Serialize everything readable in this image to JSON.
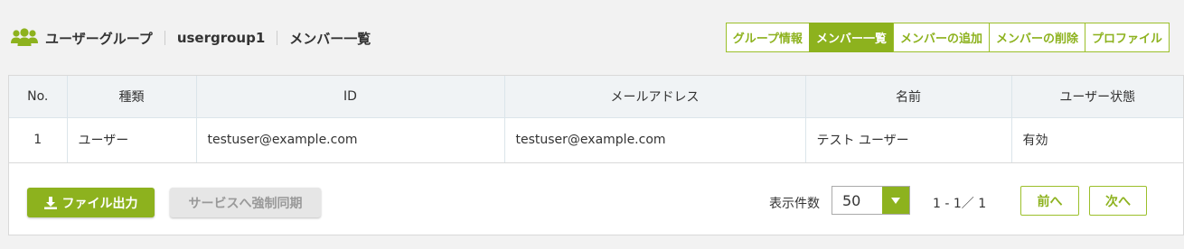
{
  "header": {
    "title": "ユーザーグループ",
    "group_name": "usergroup1",
    "page_name": "メンバー一覧"
  },
  "tabs": [
    {
      "label": "グループ情報",
      "active": false
    },
    {
      "label": "メンバー一覧",
      "active": true
    },
    {
      "label": "メンバーの追加",
      "active": false
    },
    {
      "label": "メンバーの削除",
      "active": false
    },
    {
      "label": "プロファイル",
      "active": false
    }
  ],
  "table": {
    "columns": [
      "No.",
      "種類",
      "ID",
      "メールアドレス",
      "名前",
      "ユーザー状態"
    ],
    "rows": [
      [
        "1",
        "ユーザー",
        "testuser@example.com",
        "testuser@example.com",
        "テスト ユーザー",
        "有効"
      ]
    ]
  },
  "footer": {
    "export_label": "ファイル出力",
    "sync_label": "サービスへ強制同期",
    "per_page_label": "表示件数",
    "per_page_value": "50",
    "range_text": "1 - 1／ 1",
    "prev_label": "前へ",
    "next_label": "次へ"
  },
  "colors": {
    "accent": "#8db21e",
    "disabled_bg": "#e6e6e6"
  },
  "icons": {
    "header": "users-icon",
    "export": "download-icon",
    "select": "caret-down-icon"
  }
}
